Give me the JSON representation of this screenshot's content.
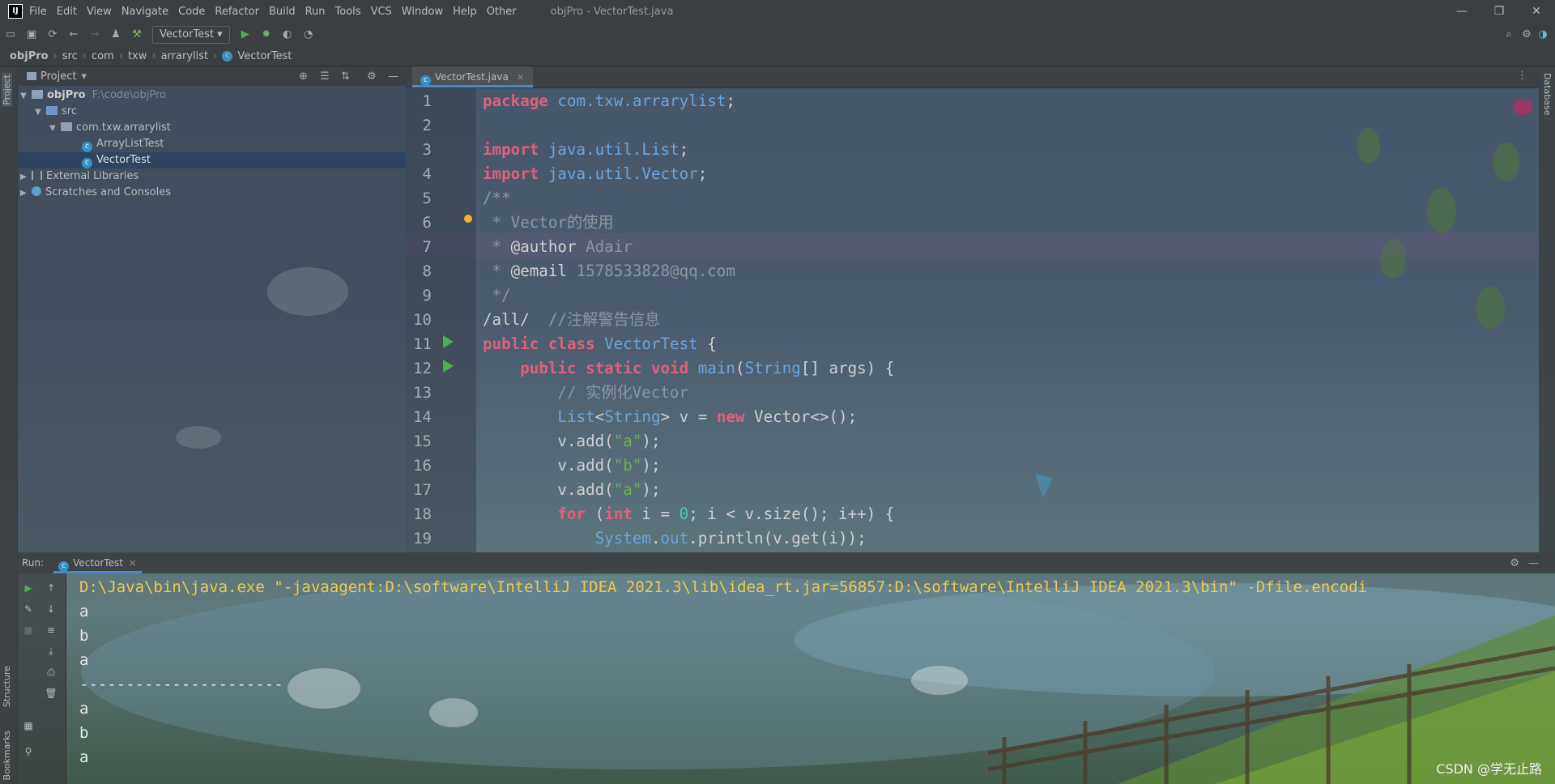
{
  "app": {
    "title": "objPro - VectorTest.java",
    "logo": "IJ",
    "menu": [
      "File",
      "Edit",
      "View",
      "Navigate",
      "Code",
      "Refactor",
      "Build",
      "Run",
      "Tools",
      "VCS",
      "Window",
      "Help",
      "Other"
    ],
    "window_buttons": [
      "—",
      "❐",
      "✕"
    ]
  },
  "toolbar": {
    "run_config": "VectorTest"
  },
  "breadcrumb": [
    "objPro",
    "src",
    "com",
    "txw",
    "arrarylist",
    "VectorTest"
  ],
  "left_strip": {
    "project_label": "Project",
    "structure_label": "Structure",
    "bookmarks_label": "Bookmarks"
  },
  "right_strip": {
    "database_label": "Database"
  },
  "project": {
    "header": "Project",
    "tree": [
      {
        "label": "objPro",
        "path": "F:\\code\\objPro"
      },
      {
        "label": "src"
      },
      {
        "label": "com.txw.arrarylist"
      },
      {
        "label": "ArrayListTest"
      },
      {
        "label": "VectorTest"
      },
      {
        "label": "External Libraries"
      },
      {
        "label": "Scratches and Consoles"
      }
    ]
  },
  "editor": {
    "tab": "VectorTest.java",
    "line_numbers": [
      "1",
      "2",
      "3",
      "4",
      "5",
      "6",
      "7",
      "8",
      "9",
      "10",
      "11",
      "12",
      "13",
      "14",
      "15",
      "16",
      "17",
      "18",
      "19"
    ]
  },
  "code": [
    [
      [
        "kw",
        "package "
      ],
      [
        "pk",
        "com.txw.arrarylist"
      ],
      [
        "",
        "; "
      ]
    ],
    [],
    [
      [
        "kw",
        "import "
      ],
      [
        "pk",
        "java.util."
      ],
      [
        "ty",
        "List"
      ],
      [
        "",
        ";"
      ]
    ],
    [
      [
        "kw",
        "import "
      ],
      [
        "pk",
        "java.util."
      ],
      [
        "ty",
        "Vector"
      ],
      [
        "",
        ";"
      ]
    ],
    [
      [
        "cm",
        "/**"
      ]
    ],
    [
      [
        "cm",
        " * Vector的使用"
      ]
    ],
    [
      [
        "cm",
        " * "
      ],
      [
        "",
        "@author"
      ],
      [
        "cm",
        " Adair"
      ]
    ],
    [
      [
        "cm",
        " * "
      ],
      [
        "",
        "@email"
      ],
      [
        "cm",
        " 1578533828@qq.com"
      ]
    ],
    [
      [
        "cm",
        " */"
      ]
    ],
    [
      [
        "",
        "/all/  "
      ],
      [
        "cm",
        "//注解警告信息"
      ]
    ],
    [
      [
        "kw",
        "public class "
      ],
      [
        "ty",
        "VectorTest "
      ],
      [
        "",
        "{"
      ]
    ],
    [
      [
        "",
        "    "
      ],
      [
        "kw",
        "public static void "
      ],
      [
        "pk",
        "main"
      ],
      [
        "",
        "("
      ],
      [
        "ty",
        "String"
      ],
      [
        "",
        "[] args) {"
      ]
    ],
    [
      [
        "cm",
        "        // 实例化Vector"
      ]
    ],
    [
      [
        "",
        "        "
      ],
      [
        "ty",
        "List"
      ],
      [
        "",
        "<"
      ],
      [
        "ty",
        "String"
      ],
      [
        "",
        "> v = "
      ],
      [
        "kw",
        "new "
      ],
      [
        "",
        "Vector<>();"
      ]
    ],
    [
      [
        "",
        "        v.add("
      ],
      [
        "st",
        "\"a\""
      ],
      [
        "",
        ");"
      ]
    ],
    [
      [
        "",
        "        v.add("
      ],
      [
        "st",
        "\"b\""
      ],
      [
        "",
        ");"
      ]
    ],
    [
      [
        "",
        "        v.add("
      ],
      [
        "st",
        "\"a\""
      ],
      [
        "",
        ");"
      ]
    ],
    [
      [
        "",
        "        "
      ],
      [
        "kw",
        "for "
      ],
      [
        "",
        "("
      ],
      [
        "kw",
        "int "
      ],
      [
        "",
        "i = "
      ],
      [
        "nm",
        "0"
      ],
      [
        "",
        "; i < v.size(); i++) {"
      ]
    ],
    [
      [
        "",
        "            "
      ],
      [
        "ty",
        "System"
      ],
      [
        "",
        "."
      ],
      [
        "pk",
        "out"
      ],
      [
        "",
        ".println(v.get(i));"
      ]
    ]
  ],
  "run": {
    "label": "Run:",
    "tab": "VectorTest",
    "console": [
      "D:\\Java\\bin\\java.exe \"-javaagent:D:\\software\\IntelliJ IDEA 2021.3\\lib\\idea_rt.jar=56857:D:\\software\\IntelliJ IDEA 2021.3\\bin\" -Dfile.encodi",
      "a",
      "b",
      "a",
      "----------------------",
      "a",
      "b",
      "a"
    ]
  },
  "watermark": "CSDN @学无止路"
}
